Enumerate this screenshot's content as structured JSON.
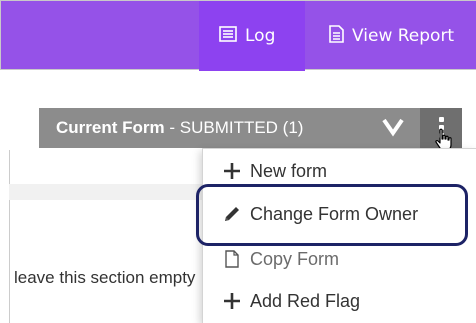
{
  "topbar": {
    "log_label": "Log",
    "report_label": "View Report",
    "background": "#9552e8",
    "log_icon": "log-icon",
    "report_icon": "report-icon"
  },
  "form_bar": {
    "title_bold": "Current Form",
    "title_separator": " - ",
    "status": "SUBMITTED (1)",
    "chevron_icon": "chevron-down-icon",
    "kebab_icon": "kebab-menu-icon",
    "background": "#8c8c8c"
  },
  "body": {
    "text": "leave this section empty"
  },
  "dropdown": {
    "items": [
      {
        "label": "New form",
        "icon": "plus-icon"
      },
      {
        "label": "Change Form Owner",
        "icon": "pencil-icon",
        "highlighted": true
      },
      {
        "label": "Copy Form",
        "icon": "copy-icon"
      },
      {
        "label": "Add Red Flag",
        "icon": "plus-icon"
      }
    ]
  },
  "colors": {
    "highlight_border": "#1d2366"
  }
}
